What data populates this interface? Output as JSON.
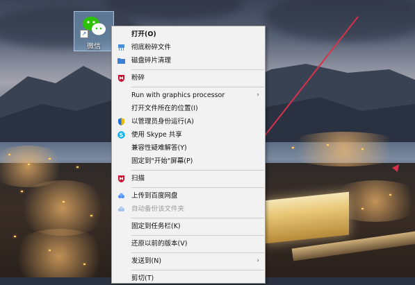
{
  "desktop": {
    "icon_label": "微信",
    "shortcut_glyph": "↗"
  },
  "menu": {
    "items": [
      {
        "label": "打开(O)",
        "icon": "none",
        "bold": true
      },
      {
        "label": "彻底粉碎文件",
        "icon": "shredder-icon"
      },
      {
        "label": "磁盘碎片清理",
        "icon": "folder-icon"
      },
      {
        "label": "粉碎",
        "icon": "mcafee-shield-icon"
      },
      {
        "label": "Run with graphics processor",
        "icon": "none",
        "submenu": true
      },
      {
        "label": "打开文件所在的位置(I)",
        "icon": "none"
      },
      {
        "label": "以管理员身份运行(A)",
        "icon": "uac-shield-icon"
      },
      {
        "label": "使用 Skype 共享",
        "icon": "skype-icon"
      },
      {
        "label": "兼容性疑难解答(Y)",
        "icon": "none"
      },
      {
        "label": "固定到\"开始\"屏幕(P)",
        "icon": "none"
      },
      {
        "label": "扫描",
        "icon": "mcafee-shield-icon"
      },
      {
        "label": "上传到百度网盘",
        "icon": "baidu-cloud-icon"
      },
      {
        "label": "自动备份该文件夹",
        "icon": "baidu-cloud-icon",
        "disabled": true
      },
      {
        "label": "固定到任务栏(K)",
        "icon": "none"
      },
      {
        "label": "还原以前的版本(V)",
        "icon": "none"
      },
      {
        "label": "发送到(N)",
        "icon": "none",
        "submenu": true
      },
      {
        "label": "剪切(T)",
        "icon": "none"
      }
    ],
    "submenu_arrow": "›"
  },
  "colors": {
    "menu_bg": "#f2f2f2",
    "annotation_arrow": "#d8324a",
    "wechat_green": "#2dc100"
  }
}
